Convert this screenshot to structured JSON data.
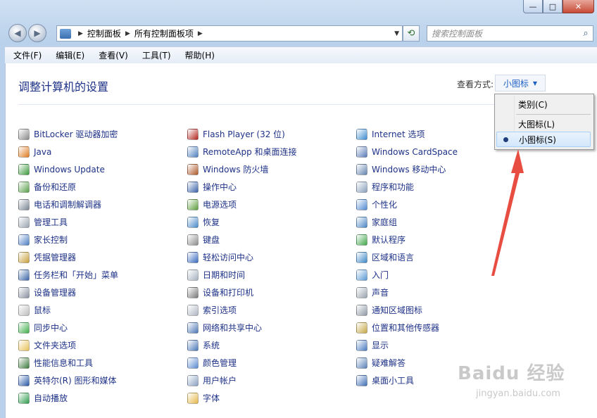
{
  "window": {
    "buttons": {
      "minimize": "—",
      "maximize": "□",
      "close": "✕"
    }
  },
  "nav": {
    "back_icon": "◀",
    "forward_icon": "▶",
    "breadcrumb": [
      "控制面板",
      "所有控制面板项"
    ],
    "refresh_icon": "⟲",
    "search_placeholder": "搜索控制面板",
    "search_icon": "⌕"
  },
  "menubar": [
    "文件(F)",
    "编辑(E)",
    "查看(V)",
    "工具(T)",
    "帮助(H)"
  ],
  "page": {
    "title": "调整计算机的设置",
    "view_by_label": "查看方式:",
    "view_by_value": "小图标"
  },
  "dropdown": {
    "items": [
      "类别(C)",
      "大图标(L)",
      "小图标(S)"
    ],
    "selected_index": 2
  },
  "columns": [
    [
      {
        "label": "BitLocker 驱动器加密",
        "color": "#8a8a8a"
      },
      {
        "label": "Java",
        "color": "#e07b21"
      },
      {
        "label": "Windows Update",
        "color": "#3c9a3c"
      },
      {
        "label": "备份和还原",
        "color": "#58a04a"
      },
      {
        "label": "电话和调制解调器",
        "color": "#7b8794"
      },
      {
        "label": "管理工具",
        "color": "#9aa4b0"
      },
      {
        "label": "家长控制",
        "color": "#4d7fc4"
      },
      {
        "label": "凭据管理器",
        "color": "#c9a13b"
      },
      {
        "label": "任务栏和「开始」菜单",
        "color": "#3b66a8"
      },
      {
        "label": "设备管理器",
        "color": "#8892a0"
      },
      {
        "label": "鼠标",
        "color": "#bfbfbf"
      },
      {
        "label": "同步中心",
        "color": "#3fae49"
      },
      {
        "label": "文件夹选项",
        "color": "#e8c25a"
      },
      {
        "label": "性能信息和工具",
        "color": "#3e7c3e"
      },
      {
        "label": "英特尔(R) 图形和媒体",
        "color": "#2a5aa8"
      },
      {
        "label": "自动播放",
        "color": "#2f9c4d"
      }
    ],
    [
      {
        "label": "Flash Player (32 位)",
        "color": "#b3261e"
      },
      {
        "label": "RemoteApp 和桌面连接",
        "color": "#4f7fbf"
      },
      {
        "label": "Windows 防火墙",
        "color": "#b05a2a"
      },
      {
        "label": "操作中心",
        "color": "#3b62a8"
      },
      {
        "label": "电源选项",
        "color": "#5c9e3c"
      },
      {
        "label": "恢复",
        "color": "#4a8ac8"
      },
      {
        "label": "键盘",
        "color": "#8d8d8d"
      },
      {
        "label": "轻松访问中心",
        "color": "#3a6cc0"
      },
      {
        "label": "日期和时间",
        "color": "#a7b3c1"
      },
      {
        "label": "设备和打印机",
        "color": "#7a7a7a"
      },
      {
        "label": "索引选项",
        "color": "#b1b8c4"
      },
      {
        "label": "网络和共享中心",
        "color": "#4d78b5"
      },
      {
        "label": "系统",
        "color": "#4b79b8"
      },
      {
        "label": "颜色管理",
        "color": "#5a8bd0"
      },
      {
        "label": "用户帐户",
        "color": "#8ba1c2"
      },
      {
        "label": "字体",
        "color": "#e6b84a"
      }
    ],
    [
      {
        "label": "Internet 选项",
        "color": "#3e8cd0"
      },
      {
        "label": "Windows CardSpace",
        "color": "#5a7ab8"
      },
      {
        "label": "Windows 移动中心",
        "color": "#6585b0"
      },
      {
        "label": "程序和功能",
        "color": "#8aa0bc"
      },
      {
        "label": "个性化",
        "color": "#4f8ad1"
      },
      {
        "label": "家庭组",
        "color": "#4a86c5"
      },
      {
        "label": "默认程序",
        "color": "#3fa74a"
      },
      {
        "label": "区域和语言",
        "color": "#3e88c8"
      },
      {
        "label": "入门",
        "color": "#5a9ad6"
      },
      {
        "label": "声音",
        "color": "#9aa3ad"
      },
      {
        "label": "通知区域图标",
        "color": "#8f99a5"
      },
      {
        "label": "位置和其他传感器",
        "color": "#c6a845"
      },
      {
        "label": "显示",
        "color": "#4a7bc0"
      },
      {
        "label": "疑难解答",
        "color": "#5b82b8"
      },
      {
        "label": "桌面小工具",
        "color": "#3f6fb6"
      }
    ]
  ],
  "watermark": {
    "brand": "Baidu 经验",
    "url": "jingyan.baidu.com"
  }
}
